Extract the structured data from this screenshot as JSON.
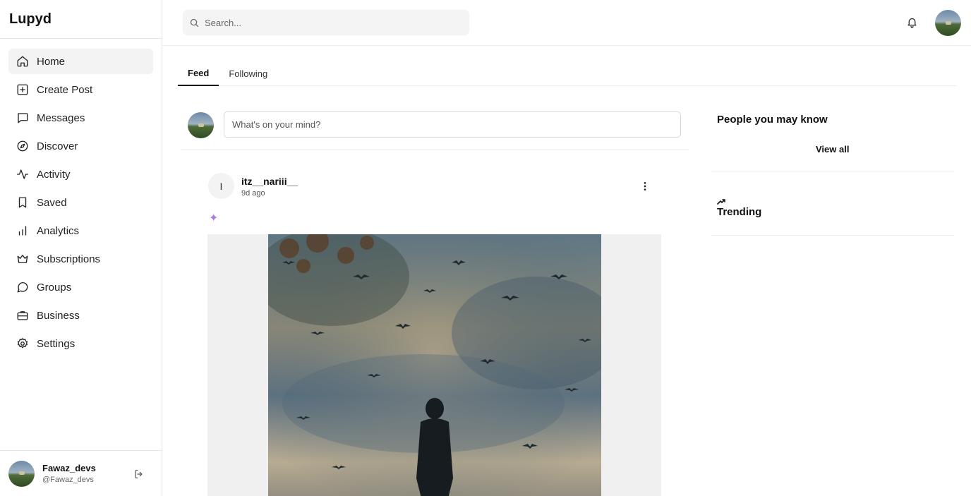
{
  "app": {
    "brand": "Lupyd"
  },
  "sidebar": {
    "items": [
      {
        "label": "Home",
        "icon": "home-icon",
        "active": true
      },
      {
        "label": "Create Post",
        "icon": "plus-square-icon"
      },
      {
        "label": "Messages",
        "icon": "message-icon"
      },
      {
        "label": "Discover",
        "icon": "compass-icon"
      },
      {
        "label": "Activity",
        "icon": "activity-icon"
      },
      {
        "label": "Saved",
        "icon": "bookmark-icon"
      },
      {
        "label": "Analytics",
        "icon": "bar-chart-icon"
      },
      {
        "label": "Subscriptions",
        "icon": "crown-icon"
      },
      {
        "label": "Groups",
        "icon": "chat-bubble-icon"
      },
      {
        "label": "Business",
        "icon": "briefcase-icon"
      },
      {
        "label": "Settings",
        "icon": "gear-icon"
      }
    ],
    "user": {
      "name": "Fawaz_devs",
      "handle": "@Fawaz_devs"
    }
  },
  "header": {
    "search_placeholder": "Search..."
  },
  "tabs": [
    {
      "label": "Feed",
      "active": true
    },
    {
      "label": "Following"
    }
  ],
  "composer": {
    "placeholder": "What's on your mind?"
  },
  "post": {
    "avatar_letter": "I",
    "username": "itz__nariii__",
    "time": "9d ago",
    "emoji": "✦"
  },
  "panel": {
    "people_title": "People you may know",
    "view_all": "View all",
    "trending_title": "Trending"
  },
  "colors": {
    "active_bg": "#f3f3f3",
    "border": "#e6e6e6"
  }
}
